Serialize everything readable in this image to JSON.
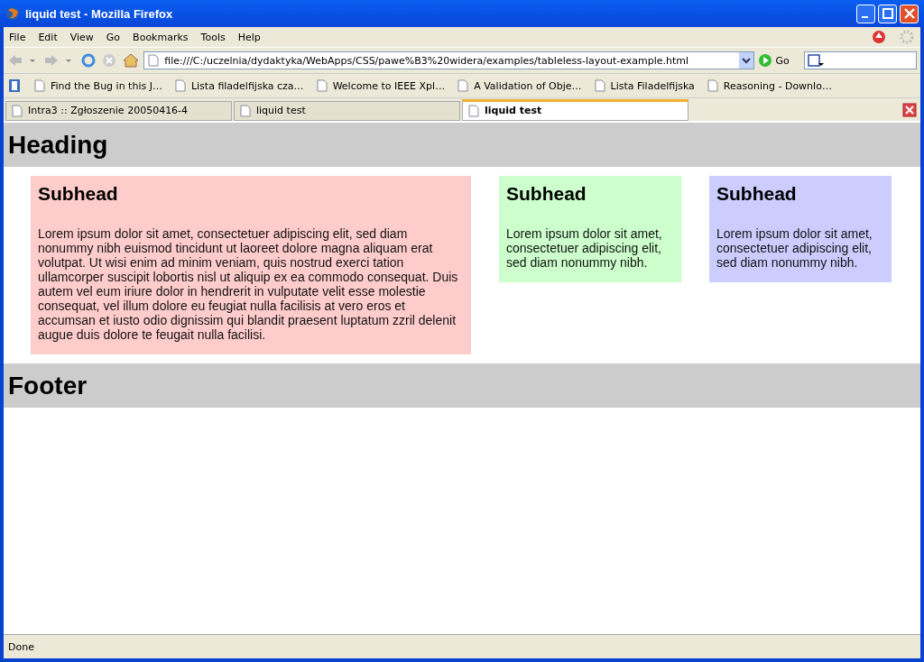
{
  "window": {
    "title": "liquid test - Mozilla Firefox"
  },
  "menu": [
    "File",
    "Edit",
    "View",
    "Go",
    "Bookmarks",
    "Tools",
    "Help"
  ],
  "address": {
    "value": "file:///C:/uczelnia/dydaktyka/WebApps/CSS/pawe%B3%20widera/examples/tableless-layout-example.html",
    "go": "Go"
  },
  "bookmarks": [
    "Find the Bug in this J…",
    "Lista filadelfijska cza…",
    "Welcome to IEEE Xpl…",
    "A Validation of Obje…",
    "Lista Filadelfijska",
    "Reasoning - Downlo…"
  ],
  "tabs": [
    {
      "label": "Intra3 :: Zgłoszenie 20050416-4",
      "selected": false
    },
    {
      "label": "liquid test",
      "selected": false
    },
    {
      "label": "liquid test",
      "selected": true
    }
  ],
  "page": {
    "heading": "Heading",
    "columns": [
      {
        "subhead": "Subhead",
        "text": "Lorem ipsum dolor sit amet, consectetuer adipiscing elit, sed diam nonummy nibh euismod tincidunt ut laoreet dolore magna aliquam erat volutpat. Ut wisi enim ad minim veniam, quis nostrud exerci tation ullamcorper suscipit lobortis nisl ut aliquip ex ea commodo consequat. Duis autem vel eum iriure dolor in hendrerit in vulputate velit esse molestie consequat, vel illum dolore eu feugiat nulla facilisis at vero eros et accumsan et iusto odio dignissim qui blandit praesent luptatum zzril delenit augue duis dolore te feugait nulla facilisi.",
        "color": "#ffcccc"
      },
      {
        "subhead": "Subhead",
        "text": "Lorem ipsum dolor sit amet, consectetuer adipiscing elit, sed diam nonummy nibh.",
        "color": "#ccffcc"
      },
      {
        "subhead": "Subhead",
        "text": "Lorem ipsum dolor sit amet, consectetuer adipiscing elit, sed diam nonummy nibh.",
        "color": "#ccccff"
      }
    ],
    "footer": "Footer"
  },
  "status_bar": "Done"
}
